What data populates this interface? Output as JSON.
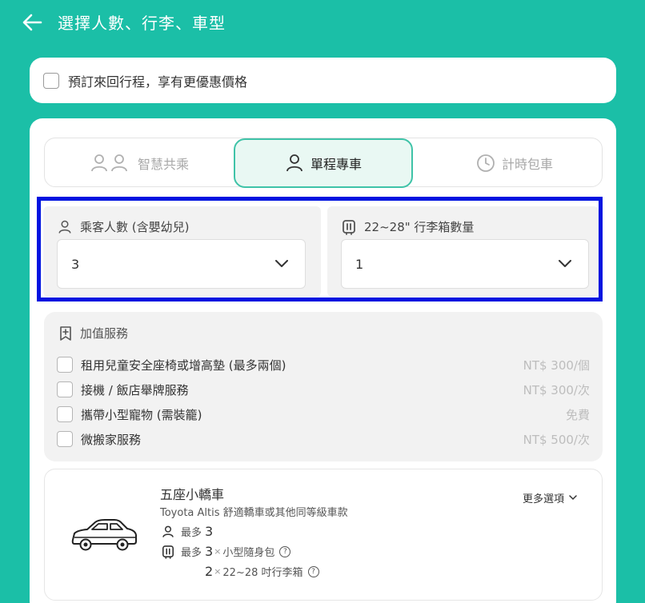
{
  "header": {
    "title": "選擇人數、行李、車型",
    "back_icon": "arrow-left-icon"
  },
  "roundtrip": {
    "label": "預訂來回行程，享有更優惠價格",
    "checked": false
  },
  "tabs": [
    {
      "label": "智慧共乘",
      "icon": "two-users-icon",
      "selected": false
    },
    {
      "label": "單程專車",
      "icon": "user-icon",
      "selected": true
    },
    {
      "label": "計時包車",
      "icon": "clock-icon",
      "selected": false
    }
  ],
  "passengers": {
    "label": "乘客人數 (含嬰幼兒)",
    "value": "3"
  },
  "luggage": {
    "label": "22~28\" 行李箱數量",
    "value": "1"
  },
  "services": {
    "title": "加值服務",
    "items": [
      {
        "name": "租用兒童安全座椅或增高墊 (最多兩個)",
        "price": "NT$ 300/個"
      },
      {
        "name": "接機 / 飯店舉牌服務",
        "price": "NT$ 300/次"
      },
      {
        "name": "攜帶小型寵物 (需裝籠)",
        "price": "免費"
      },
      {
        "name": "微搬家服務",
        "price": "NT$ 500/次"
      }
    ]
  },
  "car": {
    "name": "五座小轎車",
    "model": "Toyota Altis 舒適轎車或其他同等級車款",
    "more_label": "更多選項",
    "passenger_prefix": "最多",
    "passenger_max": "3",
    "bag_prefix": "最多",
    "bag_max": "3",
    "bag_times": "×",
    "bag_label": "小型隨身包",
    "suitcase_max": "2",
    "suitcase_times": "×",
    "suitcase_label": "22~28 吋行李箱",
    "help_glyph": "?"
  },
  "colors": {
    "background": "#1bbfa7",
    "accent": "#3fc3a8",
    "selected_tab_bg": "#e9f8f3",
    "highlight_border": "#0014e0"
  }
}
